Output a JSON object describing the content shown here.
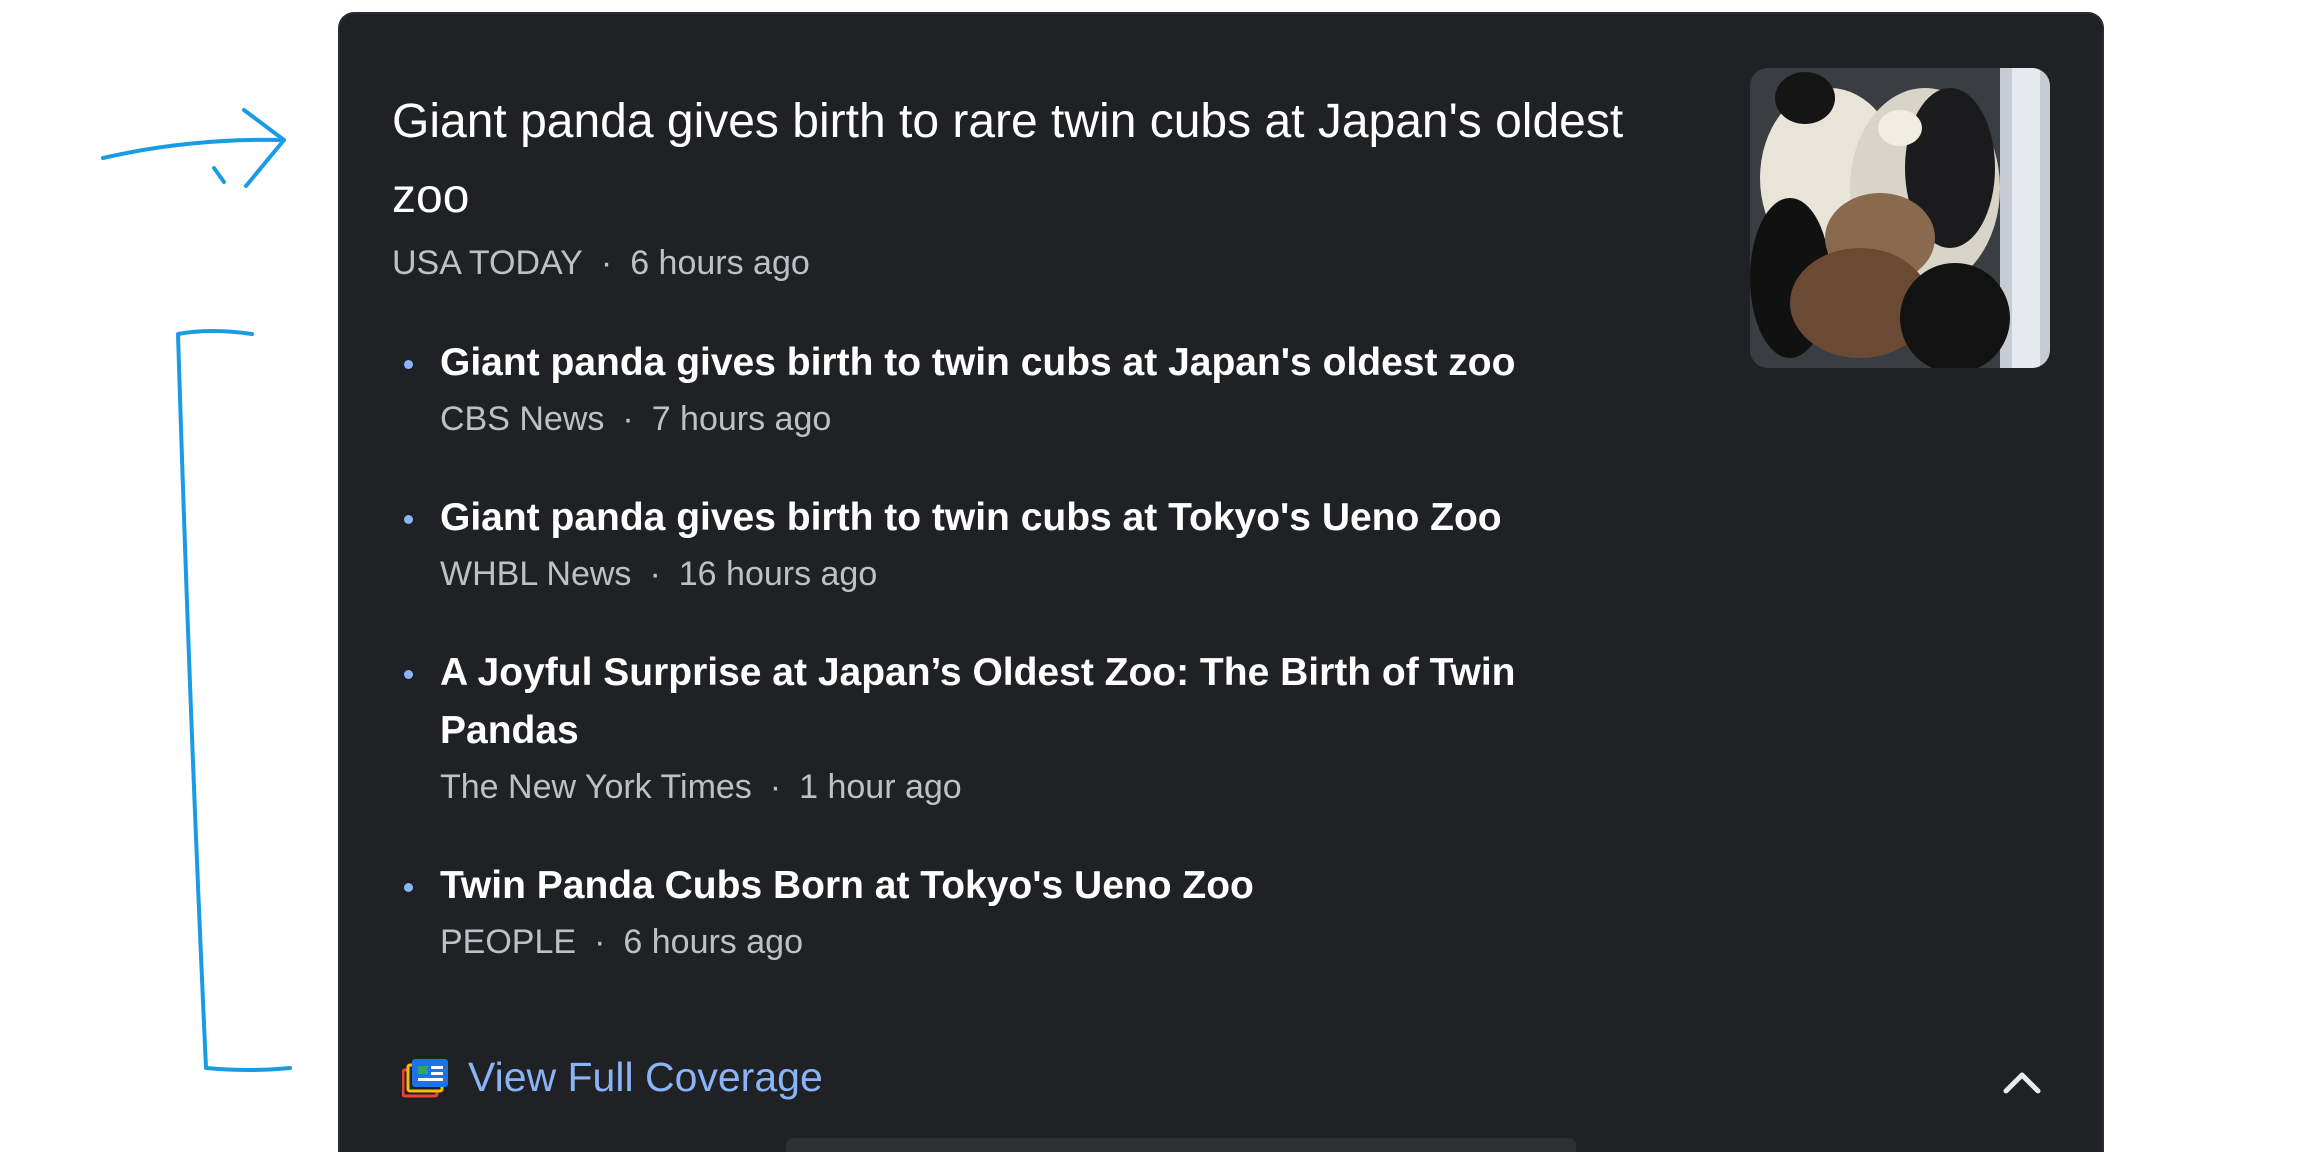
{
  "colors": {
    "card_bg": "#202124",
    "link": "#8ab4f8",
    "title": "#ffffff",
    "meta": "#bdc1c6",
    "annotation": "#1a9be6"
  },
  "top_story": {
    "title": "Giant panda gives birth to rare twin cubs at Japan's oldest zoo",
    "source": "USA TODAY",
    "time": "6 hours ago",
    "thumbnail_icon": "panda-photo"
  },
  "related": [
    {
      "title": "Giant panda gives birth to twin cubs at Japan's oldest zoo",
      "source": "CBS News",
      "time": "7 hours ago"
    },
    {
      "title": "Giant panda gives birth to twin cubs at Tokyo's Ueno Zoo",
      "source": "WHBL News",
      "time": "16 hours ago"
    },
    {
      "title": "A Joyful Surprise at Japan’s Oldest Zoo: The Birth of Twin Pandas",
      "source": "The New York Times",
      "time": "1 hour ago"
    },
    {
      "title": "Twin Panda Cubs Born at Tokyo's Ueno Zoo",
      "source": "PEOPLE",
      "time": "6 hours ago"
    }
  ],
  "footer": {
    "coverage_label": "View Full Coverage",
    "coverage_icon": "full-coverage-icon",
    "collapse_icon": "chevron-up-icon"
  },
  "separator": "·"
}
